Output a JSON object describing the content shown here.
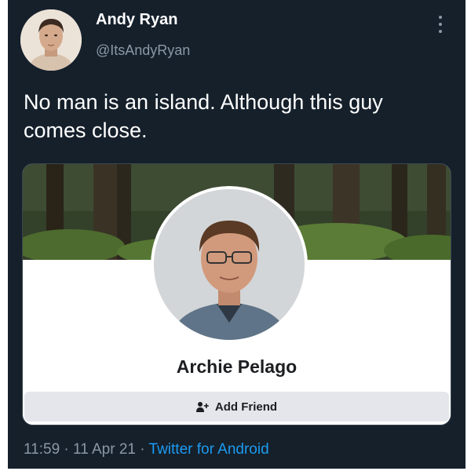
{
  "author": {
    "name": "Andy Ryan",
    "handle": "@ItsAndyRyan"
  },
  "tweet": {
    "text": "No man is an island. Although this guy comes close."
  },
  "embedded_card": {
    "profile_name": "Archie Pelago",
    "add_friend_label": "Add Friend",
    "add_friend_icon": "add-person-icon"
  },
  "meta": {
    "time": "11:59",
    "sep1": " · ",
    "date": "11 Apr 21",
    "sep2": " · ",
    "source": "Twitter for Android"
  },
  "colors": {
    "background": "#15202b",
    "text": "#ffffff",
    "secondary_text": "#8b98a5",
    "link": "#1d9bf0",
    "button_bg": "#e4e6eb"
  }
}
